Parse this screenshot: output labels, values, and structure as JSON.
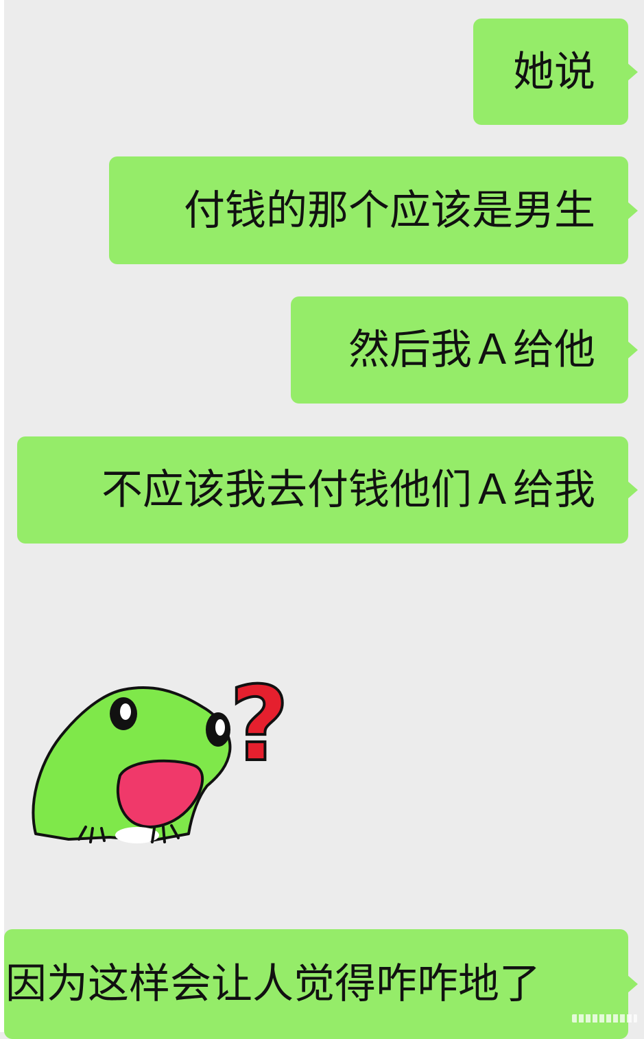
{
  "colors": {
    "background": "#ececec",
    "bubble_green": "#95ec69",
    "text": "#111111",
    "frog_green": "#7fe84a",
    "frog_mouth": "#f0396a",
    "question_red": "#e5202e"
  },
  "messages": [
    {
      "text": "她说"
    },
    {
      "text": "付钱的那个应该是男生"
    },
    {
      "text": "然后我Ａ给他"
    },
    {
      "text": "不应该我去付钱他们Ａ给我"
    },
    {
      "text": "因为这样会让人觉得咋咋地了"
    }
  ],
  "sticker": {
    "icon": "confused-frog-question-sticker",
    "symbol": "?"
  }
}
